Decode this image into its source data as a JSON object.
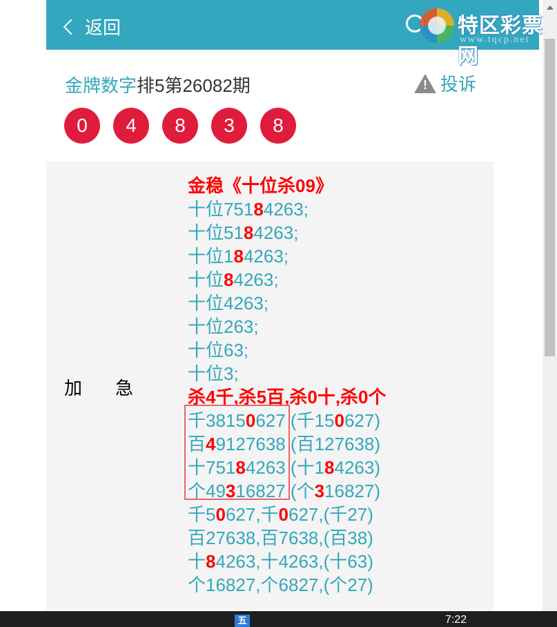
{
  "header": {
    "back_label": "返回",
    "logo_name": "特区彩票网",
    "logo_url": "www.tqcp.net"
  },
  "title": {
    "source": "金牌数字",
    "rest": "排5第26082期"
  },
  "complain_label": "投诉",
  "balls": [
    "0",
    "4",
    "8",
    "3",
    "8"
  ],
  "side_label": "加急",
  "content_lines": [
    {
      "type": "header",
      "segments": [
        {
          "t": "金稳《十位杀09》"
        }
      ]
    },
    {
      "segments": [
        {
          "t": "十位751"
        },
        {
          "t": "8",
          "hl": true
        },
        {
          "t": "4263;"
        }
      ]
    },
    {
      "segments": [
        {
          "t": "十位51"
        },
        {
          "t": "8",
          "hl": true
        },
        {
          "t": "4263;"
        }
      ]
    },
    {
      "segments": [
        {
          "t": "十位1"
        },
        {
          "t": "8",
          "hl": true
        },
        {
          "t": "4263;"
        }
      ]
    },
    {
      "segments": [
        {
          "t": "十位"
        },
        {
          "t": "8",
          "hl": true
        },
        {
          "t": "4263;"
        }
      ]
    },
    {
      "segments": [
        {
          "t": "十位4263;"
        }
      ]
    },
    {
      "segments": [
        {
          "t": "十位263;"
        }
      ]
    },
    {
      "segments": [
        {
          "t": "十位63;"
        }
      ]
    },
    {
      "segments": [
        {
          "t": "十位3;"
        }
      ]
    },
    {
      "type": "header",
      "segments": [
        {
          "t": "杀4千,杀5百,杀0十,杀0个"
        }
      ]
    },
    {
      "segments": [
        {
          "t": "千3815"
        },
        {
          "t": "0",
          "hl": true
        },
        {
          "t": "627 (千15"
        },
        {
          "t": "0",
          "hl": true
        },
        {
          "t": "627)"
        }
      ]
    },
    {
      "segments": [
        {
          "t": "百"
        },
        {
          "t": "4",
          "hl": true
        },
        {
          "t": "9127638 (百127638)"
        }
      ]
    },
    {
      "segments": [
        {
          "t": "十751"
        },
        {
          "t": "8",
          "hl": true
        },
        {
          "t": "4263 (十1"
        },
        {
          "t": "8",
          "hl": true
        },
        {
          "t": "4263)"
        }
      ]
    },
    {
      "segments": [
        {
          "t": "个49"
        },
        {
          "t": "3",
          "hl": true
        },
        {
          "t": "16827 (个"
        },
        {
          "t": "3",
          "hl": true
        },
        {
          "t": "16827)"
        }
      ]
    },
    {
      "segments": [
        {
          "t": "千5"
        },
        {
          "t": "0",
          "hl": true
        },
        {
          "t": "627,千"
        },
        {
          "t": "0",
          "hl": true
        },
        {
          "t": "627,(千27)"
        }
      ]
    },
    {
      "segments": [
        {
          "t": "百27638,百7638,(百38)"
        }
      ]
    },
    {
      "segments": [
        {
          "t": "十"
        },
        {
          "t": "8",
          "hl": true
        },
        {
          "t": "4263,十4263,(十63)"
        }
      ]
    },
    {
      "segments": [
        {
          "t": "个16827,个6827,(个27)"
        }
      ]
    }
  ],
  "taskbar": {
    "ime_label": "五",
    "time": "7:22"
  },
  "colors": {
    "accent": "#33a7bd",
    "ball": "#e01c3c",
    "highlight": "#ff0000"
  }
}
